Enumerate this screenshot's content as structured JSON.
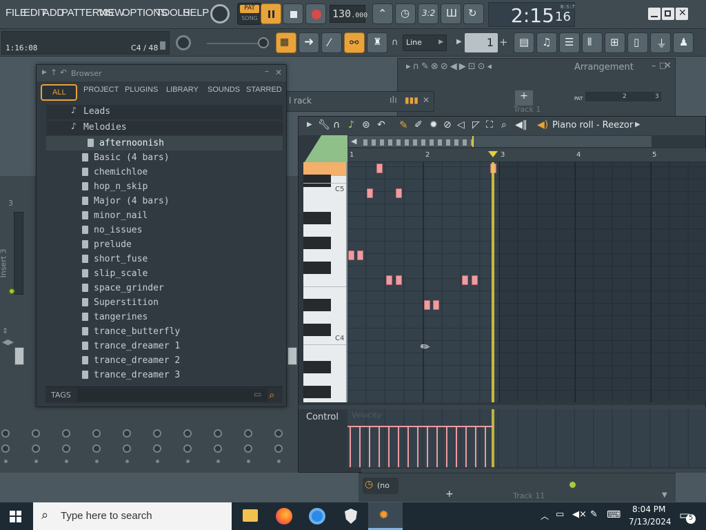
{
  "menu": [
    "FILE",
    "EDIT",
    "ADD",
    "PATTERNS",
    "VIEW",
    "OPTIONS",
    "TOOLS",
    "HELP"
  ],
  "transport": {
    "mode_label": "PAT",
    "song_label": "SONG",
    "tempo": "130",
    "tempo_dec": ".000",
    "time_main": "2:15",
    "time_sub": "16",
    "time_unit": "B:S:T"
  },
  "hint": {
    "time": "1:16:08",
    "note": "C4 / 48"
  },
  "snap": {
    "label": "Line",
    "pattern_num": "1"
  },
  "arrangement": {
    "title": "Arrangement",
    "track1": "Track 1",
    "track11": "Track 11",
    "pat_label": "PAT",
    "bar2": "2",
    "bar3": "3"
  },
  "channel_rack": {
    "title": "l rack",
    "none_label": "(no"
  },
  "mixer": {
    "insert_label": "Insert 3",
    "insert_num": "3"
  },
  "browser": {
    "title": "Browser",
    "tabs": [
      "ALL",
      "PROJECT",
      "PLUGINS",
      "LIBRARY",
      "SOUNDS",
      "STARRED"
    ],
    "folders": [
      {
        "label": "Leads"
      },
      {
        "label": "Melodies"
      }
    ],
    "selected": "afternoonish",
    "files": [
      "Basic (4 bars)",
      "chemichloe",
      "hop_n_skip",
      "Major (4 bars)",
      "minor_nail",
      "no_issues",
      "prelude",
      "short_fuse",
      "slip_scale",
      "space_grinder",
      "Superstition",
      "tangerines",
      "trance_butterfly",
      "trance_dreamer 1",
      "trance_dreamer 2",
      "trance_dreamer 3"
    ],
    "tags_label": "TAGS"
  },
  "pianoroll": {
    "title": "Piano roll - Reezor",
    "bars": [
      "1",
      "2",
      "3",
      "4",
      "5"
    ],
    "key_labels": [
      "C5",
      "C4"
    ],
    "control_label": "Control",
    "control_faded": "Velocity"
  },
  "taskbar": {
    "search_placeholder": "Type here to search",
    "time": "8:04 PM",
    "date": "7/13/2024",
    "notif_count": "5"
  },
  "colors": {
    "accent": "#e8a33a",
    "note": "#ee9ca1",
    "playhead": "#e3cf3a"
  }
}
